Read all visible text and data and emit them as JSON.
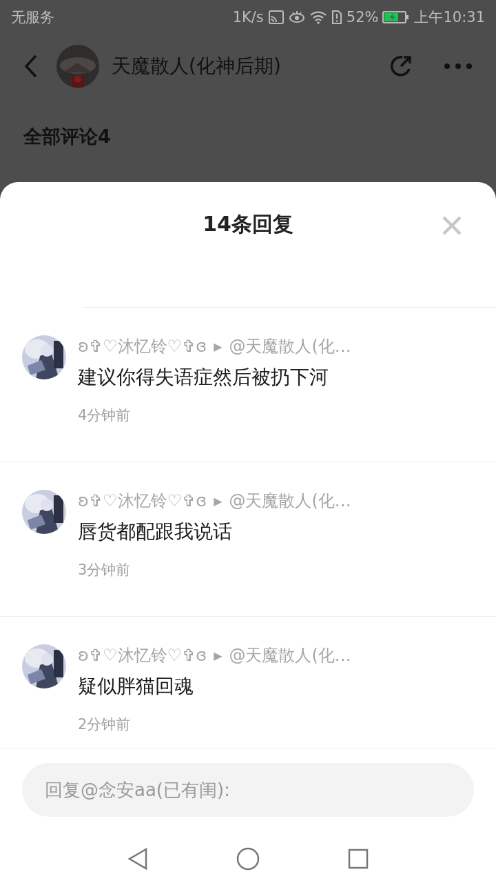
{
  "status_bar": {
    "carrier": "无服务",
    "speed": "1K/s",
    "battery": "52%",
    "time": "上午10:31"
  },
  "header": {
    "title": "天魔散人(化神后期)"
  },
  "section": {
    "title": "全部评论4"
  },
  "sheet": {
    "title": "14条回复",
    "replies": [
      {
        "author": "ʚ✞♡沐忆铃♡✞ɞ",
        "arrow": "▶",
        "target": "@天魔散人(化…",
        "text": "建议你得失语症然后被扔下河",
        "time": "4分钟前"
      },
      {
        "author": "ʚ✞♡沐忆铃♡✞ɞ",
        "arrow": "▶",
        "target": "@天魔散人(化…",
        "text": "唇货都配跟我说话",
        "time": "3分钟前"
      },
      {
        "author": "ʚ✞♡沐忆铃♡✞ɞ",
        "arrow": "▶",
        "target": "@天魔散人(化…",
        "text": "疑似胖猫回魂",
        "time": "2分钟前"
      }
    ]
  },
  "reply_box": {
    "placeholder": "回复@念安aa(已有闺):"
  }
}
